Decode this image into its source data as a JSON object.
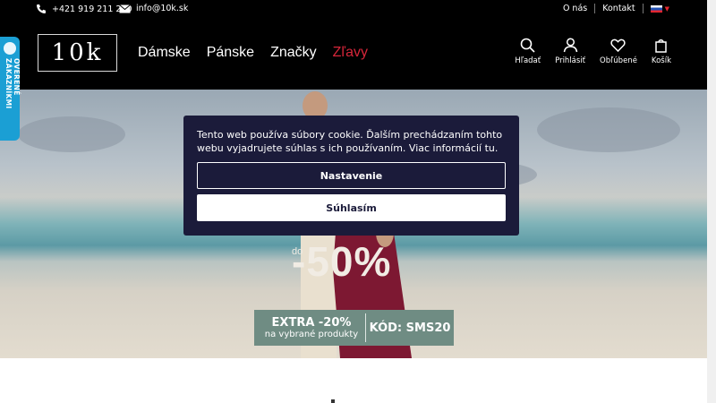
{
  "topbar": {
    "phone": "+421 919 211 240",
    "email": "info@10k.sk",
    "links": [
      "O nás",
      "Kontakt"
    ]
  },
  "header": {
    "logo": "10k",
    "nav": [
      "Dámske",
      "Pánske",
      "Značky",
      "Zľavy"
    ],
    "actions": [
      "Hľadať",
      "Prihlásiť",
      "Obľúbené",
      "Košík"
    ]
  },
  "badge": {
    "label": "OVERENÉ ZÁKAZNÍKMI"
  },
  "hero": {
    "off_prefix": "do",
    "off_value": "-50%",
    "extra": "EXTRA -20%",
    "extra_sub": "na vybrané produkty",
    "code": "KÓD: SMS20"
  },
  "cookie": {
    "message": "Tento web používa súbory cookie. Ďalším prechádzaním tohto webu vyjadrujete súhlas s ich používaním. Viac informácií tu.",
    "settings_label": "Nastavenie",
    "accept_label": "Súhlasím"
  },
  "colors": {
    "accent_sale": "#d6263a",
    "badge": "#1b9fd4",
    "modal": "#1b1b3a"
  }
}
